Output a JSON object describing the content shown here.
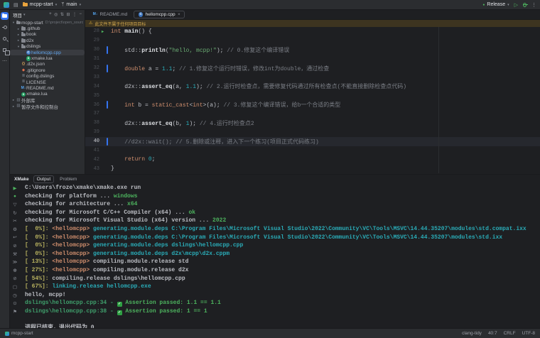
{
  "titlebar": {
    "project": "mcpp-start",
    "branch": "main",
    "run_config": "Release"
  },
  "icons": {
    "chevron_down": "▾",
    "chevron_right": "▸",
    "more_v": "⋮",
    "more_h": "⋯",
    "layout": "▤",
    "branch": "ᛘ",
    "play_outline": "▷",
    "run_dot": "●",
    "close": "×",
    "warning": "⚠",
    "check": "✓",
    "minus": "−",
    "cpp": "C",
    "xmake": "x",
    "json": "{}",
    "git": "◆",
    "file": "≣",
    "md": "M↓",
    "lib": "▥",
    "scratch": "▧"
  },
  "colors": {
    "accent_blue": "#3574f0",
    "run_green": "#4db35e",
    "teal": "#2aacb8",
    "warning_yellow": "#e8b437",
    "selected_file_blue": "#62a8f0"
  },
  "activity_bar": {
    "items": [
      {
        "name": "files",
        "active": true
      },
      {
        "name": "vcs",
        "active": false
      },
      {
        "name": "search",
        "active": false
      },
      {
        "name": "extensions",
        "active": false
      },
      {
        "name": "more",
        "active": false
      }
    ]
  },
  "sidebar": {
    "header": {
      "title": "项目",
      "actions": [
        {
          "name": "add",
          "glyph": "+"
        },
        {
          "name": "locate",
          "glyph": "◎"
        },
        {
          "name": "sort",
          "glyph": "⇅"
        },
        {
          "name": "collapse-all",
          "glyph": "⊟"
        },
        {
          "name": "more",
          "glyph": "⋮"
        },
        {
          "name": "hide",
          "glyph": "−"
        }
      ]
    },
    "tree": [
      {
        "indent": 0,
        "chev": "down",
        "icon": "folder",
        "label": "mcpp-start",
        "extra": "D:\\project\\open_source\\mcpp"
      },
      {
        "indent": 1,
        "chev": "right",
        "icon": "folder",
        "label": ".github"
      },
      {
        "indent": 1,
        "chev": "right",
        "icon": "folder",
        "label": "book"
      },
      {
        "indent": 1,
        "chev": "right",
        "icon": "folder",
        "label": "d2x"
      },
      {
        "indent": 1,
        "chev": "down",
        "icon": "folder",
        "label": "dslings"
      },
      {
        "indent": 2,
        "chev": null,
        "icon": "cpp",
        "label": "hellomcpp.cpp",
        "selected": true
      },
      {
        "indent": 2,
        "chev": null,
        "icon": "xmake",
        "label": "xmake.lua"
      },
      {
        "indent": 1,
        "chev": null,
        "icon": "json",
        "label": ".d2x.json"
      },
      {
        "indent": 1,
        "chev": null,
        "icon": "git",
        "label": ".gitignore"
      },
      {
        "indent": 1,
        "chev": null,
        "icon": "file",
        "label": "config.dslings"
      },
      {
        "indent": 1,
        "chev": null,
        "icon": "file",
        "label": "LICENSE"
      },
      {
        "indent": 1,
        "chev": null,
        "icon": "md",
        "label": "README.md"
      },
      {
        "indent": 1,
        "chev": null,
        "icon": "xmake",
        "label": "xmake.lua"
      },
      {
        "indent": 0,
        "chev": "right",
        "icon": "lib",
        "label": "外部库"
      },
      {
        "indent": 0,
        "chev": "right",
        "icon": "scratch",
        "label": "暂存文件和控制台"
      }
    ]
  },
  "editor": {
    "tabs": [
      {
        "label": "README.md",
        "icon": "md",
        "active": false,
        "closable": false
      },
      {
        "label": "hellomcpp.cpp",
        "icon": "cpp",
        "active": true,
        "closable": true
      }
    ],
    "warning": "此文件不属于任何项目目标",
    "code": [
      {
        "n": 28,
        "run": true,
        "bar": false,
        "t": [
          [
            "kw",
            "int"
          ],
          [
            "pl",
            " "
          ],
          [
            "fn",
            "main"
          ],
          [
            "pl",
            "() {"
          ]
        ]
      },
      {
        "n": 29,
        "t": []
      },
      {
        "n": 30,
        "bar": true,
        "t": [
          [
            "pl",
            "    std::"
          ],
          [
            "fn",
            "println"
          ],
          [
            "pl",
            "("
          ],
          [
            "str",
            "\"hello, mcpp!\""
          ],
          [
            "pl",
            "); "
          ],
          [
            "cmt",
            "// 0.修复这个编译错误"
          ]
        ]
      },
      {
        "n": 31,
        "t": []
      },
      {
        "n": 32,
        "bar": true,
        "t": [
          [
            "pl",
            "    "
          ],
          [
            "kw",
            "double"
          ],
          [
            "pl",
            " a = "
          ],
          [
            "num",
            "1.1"
          ],
          [
            "pl",
            "; "
          ],
          [
            "cmt",
            "// 1.修复这个运行时错误，修改int为double，通过检查"
          ]
        ]
      },
      {
        "n": 33,
        "t": []
      },
      {
        "n": 34,
        "t": [
          [
            "pl",
            "    d2x::"
          ],
          [
            "fn",
            "assert_eq"
          ],
          [
            "pl",
            "(a, "
          ],
          [
            "num",
            "1.1"
          ],
          [
            "pl",
            "); "
          ],
          [
            "cmt",
            "// 2.运行时检查点，需要修复代码通过所有检查点(不能直接删除检查点代码)"
          ]
        ]
      },
      {
        "n": 35,
        "t": []
      },
      {
        "n": 36,
        "bar": true,
        "t": [
          [
            "pl",
            "    "
          ],
          [
            "kw",
            "int"
          ],
          [
            "pl",
            " b = "
          ],
          [
            "kw",
            "static_cast"
          ],
          [
            "pl",
            "<"
          ],
          [
            "kw",
            "int"
          ],
          [
            "pl",
            ">(a); "
          ],
          [
            "cmt",
            "// 3.修复这个编译错误，给b一个合适的类型"
          ]
        ]
      },
      {
        "n": 37,
        "t": []
      },
      {
        "n": 38,
        "t": [
          [
            "pl",
            "    d2x::"
          ],
          [
            "fn",
            "assert_eq"
          ],
          [
            "pl",
            "(b, "
          ],
          [
            "num",
            "1"
          ],
          [
            "pl",
            "); "
          ],
          [
            "cmt",
            "// 4.运行时检查点2"
          ]
        ]
      },
      {
        "n": 39,
        "t": []
      },
      {
        "n": 40,
        "bar": true,
        "active": true,
        "t": [
          [
            "cmt",
            "    //d2x::wait(); // 5.删除或注释，进入下一个练习(项目正式代码练习)"
          ]
        ]
      },
      {
        "n": 41,
        "t": []
      },
      {
        "n": 42,
        "t": [
          [
            "pl",
            "    "
          ],
          [
            "kw",
            "return"
          ],
          [
            "pl",
            " "
          ],
          [
            "num",
            "0"
          ],
          [
            "pl",
            ";"
          ]
        ]
      },
      {
        "n": 43,
        "t": [
          [
            "pl",
            "}"
          ]
        ]
      }
    ]
  },
  "panel": {
    "tool": "XMake",
    "tabs": [
      {
        "label": "Output",
        "active": true
      },
      {
        "label": "Problem",
        "active": false
      }
    ],
    "toolbar": [
      {
        "name": "run",
        "glyph": "▶",
        "color": "#4db35e"
      },
      {
        "name": "status",
        "glyph": "●",
        "color": "#4db35e"
      },
      {
        "name": "filter",
        "glyph": "▽",
        "color": ""
      },
      {
        "name": "restart",
        "glyph": "↻",
        "color": ""
      },
      {
        "name": "clear",
        "glyph": "✂",
        "color": ""
      },
      {
        "name": "settings",
        "glyph": "⚙",
        "color": ""
      },
      {
        "name": "soft-wrap",
        "glyph": "↩",
        "color": ""
      },
      {
        "name": "ignore",
        "glyph": "⊘",
        "color": ""
      },
      {
        "name": "tools",
        "glyph": "⚒",
        "color": ""
      },
      {
        "name": "scroll-to-end",
        "glyph": "≫",
        "color": ""
      },
      {
        "name": "config",
        "glyph": "☸",
        "color": ""
      },
      {
        "name": "ban",
        "glyph": "⊘",
        "color": ""
      },
      {
        "name": "stop-square",
        "glyph": "▢",
        "color": ""
      },
      {
        "name": "history",
        "glyph": "◷",
        "color": ""
      },
      {
        "name": "power",
        "glyph": "⊙",
        "color": ""
      },
      {
        "name": "flag",
        "glyph": "⚑",
        "color": ""
      }
    ],
    "lines": [
      [
        [
          "pl",
          "C:\\Users\\froze\\xmake\\xmake.exe run"
        ]
      ],
      [
        [
          "pl",
          "checking for platform ... "
        ],
        [
          "grn",
          "windows"
        ]
      ],
      [
        [
          "pl",
          "checking for architecture ... "
        ],
        [
          "grn",
          "x64"
        ]
      ],
      [
        [
          "pl",
          "checking for Microsoft C/C++ Compiler (x64) ... "
        ],
        [
          "grn",
          "ok"
        ]
      ],
      [
        [
          "pl",
          "checking for Microsoft Visual Studio (x64) version ... "
        ],
        [
          "grn",
          "2022"
        ]
      ],
      [
        [
          "yel",
          "[  0%]: "
        ],
        [
          "org",
          "<hellomcpp> "
        ],
        [
          "teal",
          "generating.module.deps C:\\Program Files\\Microsoft Visual Studio\\2022\\Community\\VC\\Tools\\MSVC\\14.44.35207\\modules\\std.compat.ixx"
        ]
      ],
      [
        [
          "yel",
          "[  0%]: "
        ],
        [
          "org",
          "<hellomcpp> "
        ],
        [
          "teal",
          "generating.module.deps C:\\Program Files\\Microsoft Visual Studio\\2022\\Community\\VC\\Tools\\MSVC\\14.44.35207\\modules\\std.ixx"
        ]
      ],
      [
        [
          "yel",
          "[  0%]: "
        ],
        [
          "org",
          "<hellomcpp> "
        ],
        [
          "teal",
          "generating.module.deps dslings\\hellomcpp.cpp"
        ]
      ],
      [
        [
          "yel",
          "[  0%]: "
        ],
        [
          "org",
          "<hellomcpp> "
        ],
        [
          "teal",
          "generating.module.deps d2x\\mcpp\\d2x.cppm"
        ]
      ],
      [
        [
          "yel",
          "[ 13%]: "
        ],
        [
          "org",
          "<hellomcpp> "
        ],
        [
          "pl",
          "compiling.module.release std"
        ]
      ],
      [
        [
          "yel",
          "[ 27%]: "
        ],
        [
          "org",
          "<hellomcpp> "
        ],
        [
          "pl",
          "compiling.module.release d2x"
        ]
      ],
      [
        [
          "yel",
          "[ 54%]: "
        ],
        [
          "pl",
          "compiling.release dslings\\hellomcpp.cpp"
        ]
      ],
      [
        [
          "yel",
          "[ 67%]: "
        ],
        [
          "teal",
          "linking.release hellomcpp.exe"
        ]
      ],
      [
        [
          "pl",
          "hello, mcpp!"
        ]
      ],
      [
        [
          "grnD",
          "dslings\\hellomcpp.cpp:34 - "
        ],
        [
          "chk",
          ""
        ],
        [
          "grn",
          " Assertion passed: 1.1 == 1.1"
        ]
      ],
      [
        [
          "grnD",
          "dslings\\hellomcpp.cpp:38 - "
        ],
        [
          "chk",
          ""
        ],
        [
          "grn",
          " Assertion passed: 1 == 1"
        ]
      ],
      [],
      [
        [
          "pl",
          "进程已结束，退出代码为 0"
        ]
      ]
    ]
  },
  "statusbar": {
    "project": "mcpp-start",
    "items": [
      "clang-tidy",
      "40:7",
      "CRLF",
      "UTF-8"
    ]
  }
}
